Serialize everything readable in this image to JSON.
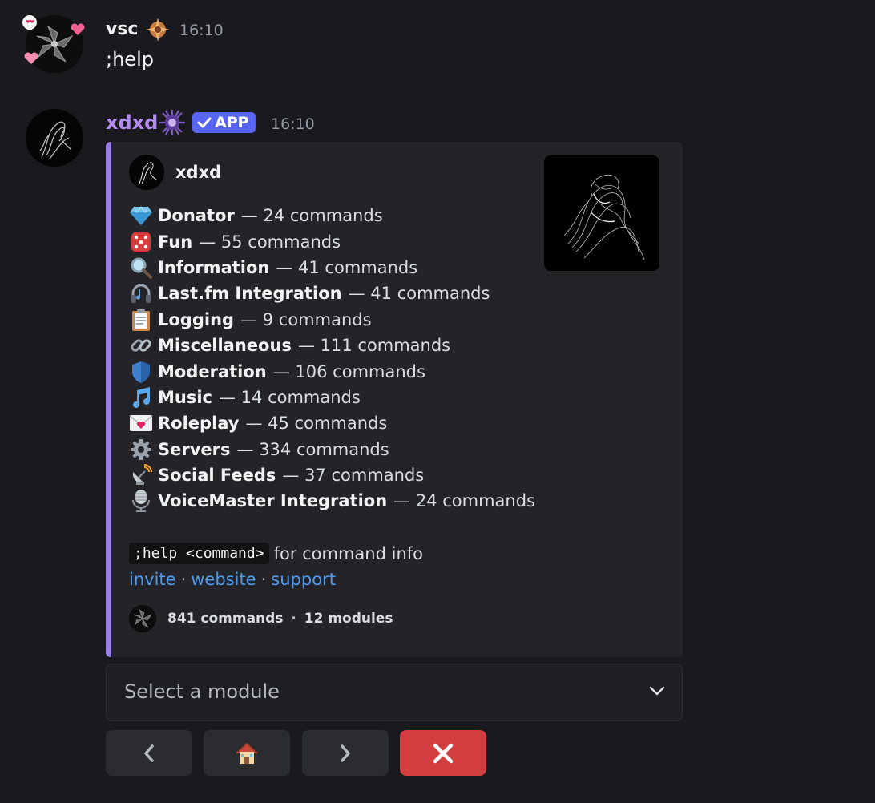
{
  "messages": [
    {
      "username": "vsc",
      "timestamp": "16:10",
      "content": ";help",
      "username_color": "#f2f3f5"
    },
    {
      "username": "xdxd",
      "timestamp": "16:10",
      "app_tag": "APP",
      "username_color": "#b48cf2"
    }
  ],
  "embed": {
    "author_name": "xdxd",
    "accent_color": "#9b80e8",
    "modules": [
      {
        "icon": "gem-icon",
        "name": "Donator",
        "count": "— 24 commands"
      },
      {
        "icon": "dice-icon",
        "name": "Fun",
        "count": "— 55 commands"
      },
      {
        "icon": "magnifier-icon",
        "name": "Information",
        "count": "— 41 commands"
      },
      {
        "icon": "headphones-icon",
        "name": "Last.fm Integration",
        "count": "— 41 commands"
      },
      {
        "icon": "clipboard-icon",
        "name": "Logging",
        "count": "— 9 commands"
      },
      {
        "icon": "link-icon",
        "name": "Miscellaneous",
        "count": "— 111 commands"
      },
      {
        "icon": "shield-icon",
        "name": "Moderation",
        "count": "— 106 commands"
      },
      {
        "icon": "music-note-icon",
        "name": "Music",
        "count": "— 14 commands"
      },
      {
        "icon": "love-letter-icon",
        "name": "Roleplay",
        "count": "— 45 commands"
      },
      {
        "icon": "gear-icon",
        "name": "Servers",
        "count": "— 334 commands"
      },
      {
        "icon": "satellite-icon",
        "name": "Social Feeds",
        "count": "— 37 commands"
      },
      {
        "icon": "microphone-icon",
        "name": "VoiceMaster Integration",
        "count": "— 24 commands"
      }
    ],
    "help_code": ";help <command>",
    "help_text": "for command info",
    "links": {
      "invite": "invite",
      "website": "website",
      "support": "support",
      "separator": "·"
    },
    "footer": {
      "commands": "841 commands",
      "separator": "·",
      "modules": "12 modules"
    }
  },
  "select_menu": {
    "placeholder": "Select a module"
  },
  "buttons": [
    {
      "icon": "chevron-left-icon"
    },
    {
      "icon": "house-icon"
    },
    {
      "icon": "chevron-right-icon"
    },
    {
      "icon": "close-icon",
      "color": "#d23d3f"
    }
  ]
}
